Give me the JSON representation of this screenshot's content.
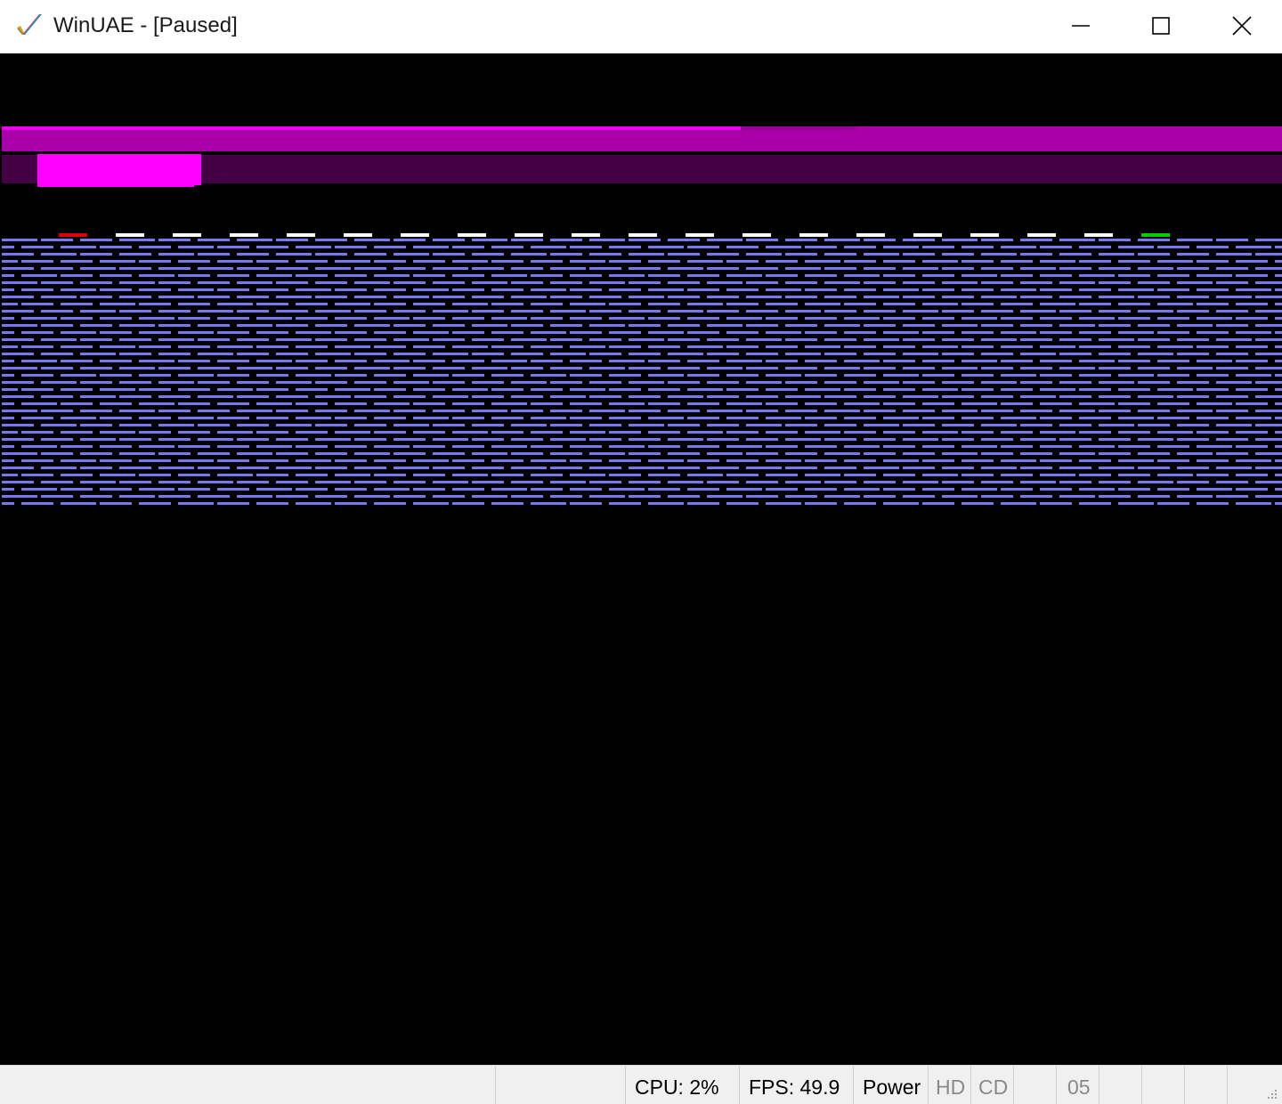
{
  "window": {
    "title": "WinUAE - [Paused]",
    "app_icon": "winuae-checkmark-icon",
    "controls": {
      "minimize_icon": "minimize-icon",
      "maximize_icon": "maximize-icon",
      "close_icon": "close-icon"
    }
  },
  "display": {
    "state": "paused",
    "colors": {
      "background": "#000000",
      "top_bar_light": "#ee00ee",
      "top_bar_mid": "#aa00aa",
      "top_bar_dark": "#440044",
      "paddle": "#ff00ff",
      "bricks": "#7777ee",
      "marker_white": "#ffffff",
      "marker_red": "#dd0000",
      "marker_green": "#00cc00"
    }
  },
  "statusbar": {
    "cells": [
      {
        "label": "",
        "dim": false
      },
      {
        "label": "",
        "dim": false
      },
      {
        "label": "CPU: 2%",
        "dim": false
      },
      {
        "label": "FPS: 49.9",
        "dim": false
      },
      {
        "label": "Power",
        "dim": false
      },
      {
        "label": "HD",
        "dim": true
      },
      {
        "label": "CD",
        "dim": true
      },
      {
        "label": "",
        "dim": false
      },
      {
        "label": "05",
        "dim": true
      },
      {
        "label": "",
        "dim": false
      },
      {
        "label": "",
        "dim": false
      },
      {
        "label": "",
        "dim": false
      },
      {
        "label": "",
        "dim": false
      }
    ],
    "resize_grip_icon": "resize-grip-icon"
  }
}
